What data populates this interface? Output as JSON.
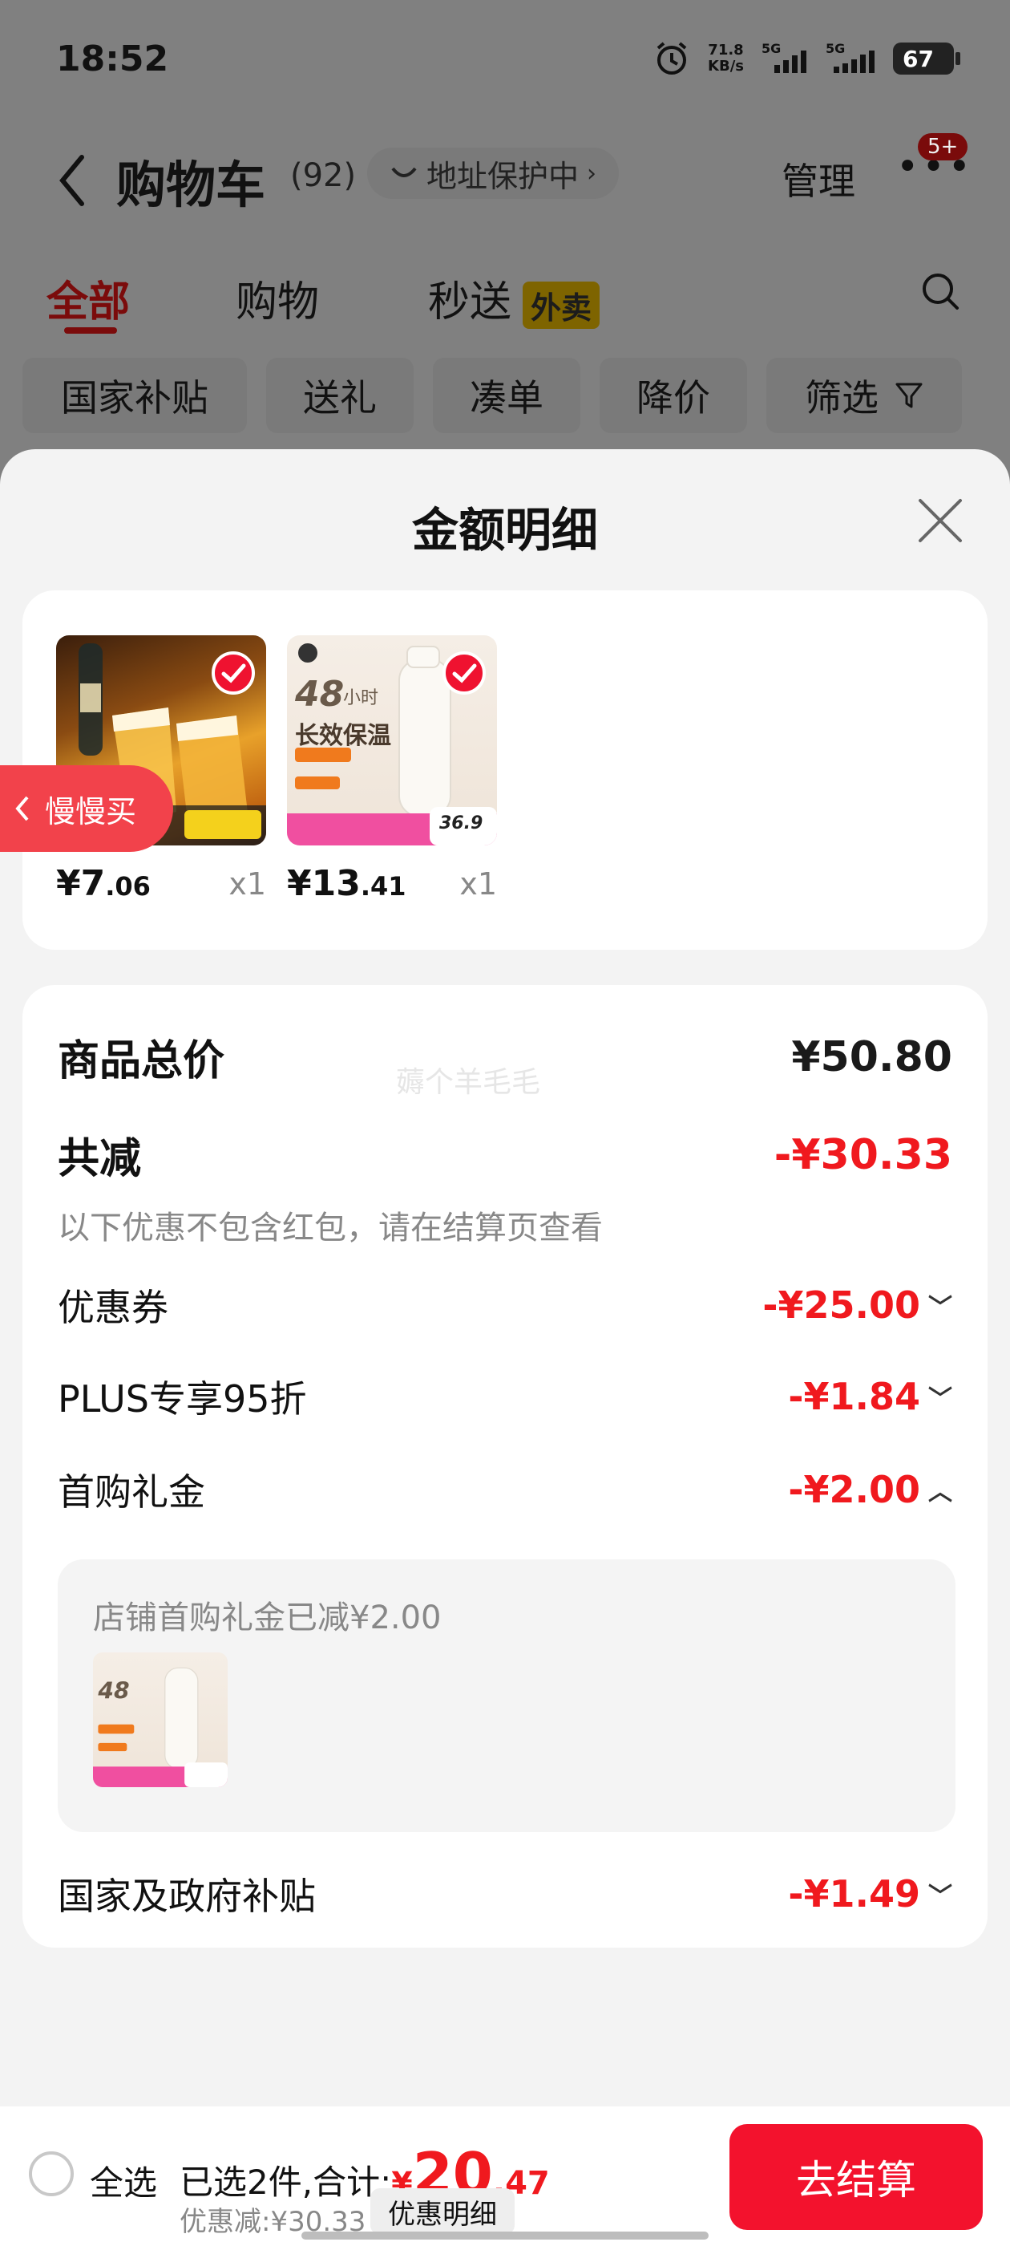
{
  "status_bar": {
    "time": "18:52",
    "net_speed": "71.8",
    "net_unit": "KB/s",
    "sig1": "5G",
    "sig2": "5G",
    "battery": "67"
  },
  "header": {
    "title": "购物车",
    "count": "(92)",
    "address": "地址保护中",
    "manage": "管理",
    "badge": "5+"
  },
  "tabs": [
    {
      "label": "全部"
    },
    {
      "label": "购物"
    },
    {
      "label": "秒送"
    }
  ],
  "tabs_tag": "外卖",
  "chips": [
    "国家补贴",
    "送礼",
    "凑单",
    "降价",
    "筛选"
  ],
  "sheet": {
    "title": "金额明细",
    "products": [
      {
        "price_int": "¥7",
        "price_dec": ".06",
        "qty": "x1"
      },
      {
        "price_int": "¥13",
        "price_dec": ".41",
        "qty": "x1",
        "img_hour": "48",
        "img_unit": "小时",
        "img_title": "长效保温",
        "img_price": "36.9"
      }
    ],
    "slow_buy": "慢慢买",
    "watermark": "薅个羊毛毛",
    "total_label": "商品总价",
    "total_value": "¥50.80",
    "reduce_label": "共减",
    "reduce_value": "-¥30.33",
    "reduce_note": "以下优惠不包含红包，请在结算页查看",
    "discounts": [
      {
        "label": "优惠券",
        "value": "-¥25.00",
        "state": "collapsed"
      },
      {
        "label": "PLUS专享95折",
        "value": "-¥1.84",
        "state": "collapsed"
      },
      {
        "label": "首购礼金",
        "value": "-¥2.00",
        "state": "expanded"
      },
      {
        "label": "国家及政府补贴",
        "value": "-¥1.49",
        "state": "collapsed"
      }
    ],
    "gift_detail": "店铺首购礼金已减¥2.00"
  },
  "footer": {
    "select_all": "全选",
    "selected": "已选2件,合计:",
    "currency": "¥",
    "total_int": "20",
    "total_dec": ".47",
    "saved": "优惠减:¥30.33",
    "detail_button": "优惠明细",
    "checkout": "去结算"
  },
  "colors": {
    "accent_red": "#f0191e",
    "checkout_red": "#f3122d",
    "slow_buy_red": "#f2424b"
  }
}
